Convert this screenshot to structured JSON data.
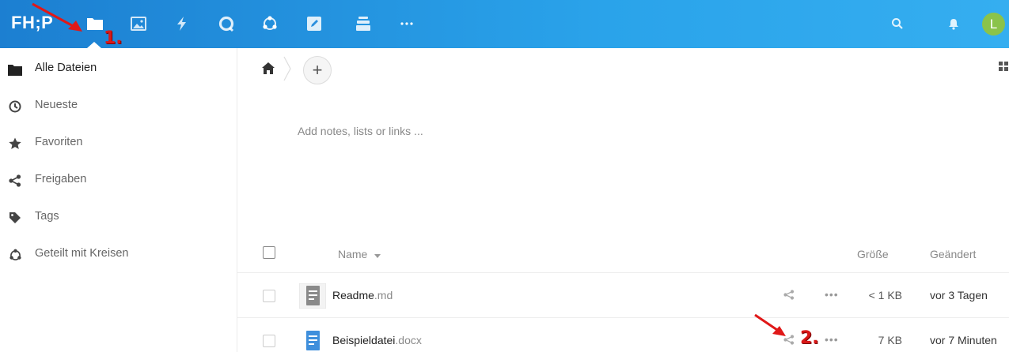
{
  "header": {
    "logo": "FH;P",
    "apps": [
      {
        "name": "files-app-icon"
      },
      {
        "name": "photos-app-icon"
      },
      {
        "name": "activity-app-icon"
      },
      {
        "name": "talk-app-icon"
      },
      {
        "name": "circles-app-icon"
      },
      {
        "name": "notes-app-icon"
      },
      {
        "name": "deck-app-icon"
      },
      {
        "name": "more-apps-icon"
      }
    ],
    "avatar_initial": "L",
    "accent": "#1c7fd1"
  },
  "sidebar": {
    "items": [
      {
        "label": "Alle Dateien",
        "icon": "folder-icon"
      },
      {
        "label": "Neueste",
        "icon": "clock-icon"
      },
      {
        "label": "Favoriten",
        "icon": "star-icon"
      },
      {
        "label": "Freigaben",
        "icon": "share-icon"
      },
      {
        "label": "Tags",
        "icon": "tag-icon"
      },
      {
        "label": "Geteilt mit Kreisen",
        "icon": "circles-icon"
      }
    ]
  },
  "main": {
    "add_button": "+",
    "notes_placeholder": "Add notes, lists or links ...",
    "columns": {
      "name": "Name",
      "size": "Größe",
      "modified": "Geändert"
    },
    "files": [
      {
        "base": "Readme",
        "ext": ".md",
        "more": "•••",
        "size": "< 1 KB",
        "modified": "vor 3 Tagen",
        "icon_color": "#8a8a8a"
      },
      {
        "base": "Beispieldatei",
        "ext": ".docx",
        "more": "•••",
        "size": "7 KB",
        "modified": "vor 7 Minuten",
        "icon_color": "#3f8fdc"
      }
    ]
  },
  "annotations": {
    "step1": "1.",
    "step2": "2.",
    "color": "#e01818"
  }
}
